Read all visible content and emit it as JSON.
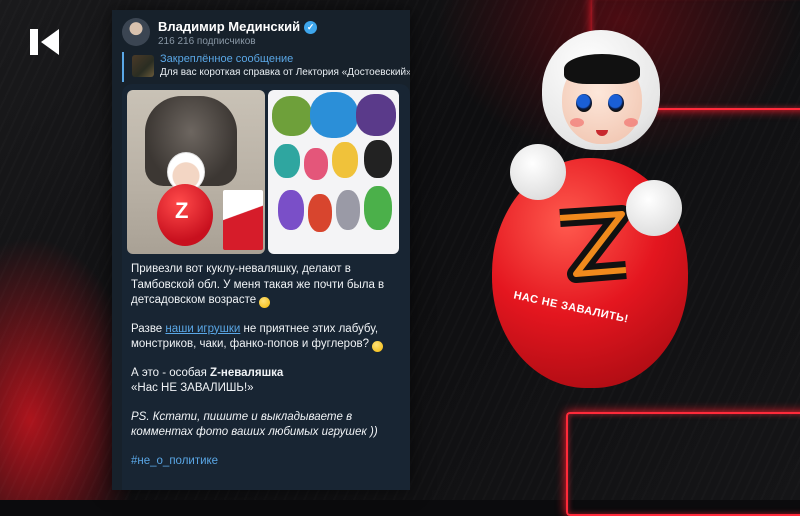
{
  "channel": {
    "name": "Владимир Мединский",
    "subscribers": "216 216 подписчиков"
  },
  "pinned": {
    "title": "Закреплённое сообщение",
    "text": "Для вас короткая справка от Лектория «Достоевский»"
  },
  "post": {
    "paragraph1": "Привезли вот куклу-неваляшку, делают в Тамбовской обл. У меня такая же почти была в детсадовском возрасте",
    "paragraph2_before": "Разве ",
    "paragraph2_link": "наши игрушки",
    "paragraph2_after": " не приятнее этих лабубу, монстриков, чаки, фанко-попов и фуглеров?",
    "paragraph3_before": "А это - особая ",
    "paragraph3_bold": "Z-неваляшка",
    "paragraph3_quote": "«Нас НЕ ЗАВАЛИШЬ!»",
    "paragraph4": "PS. Кстати, пишите и выкладываете в комментах фото ваших любимых игрушек ))",
    "hashtag": "#не_о_политике"
  },
  "doll": {
    "slogan": "НАС НЕ ЗАВАЛИТЬ!"
  },
  "colors": {
    "accent_red": "#ff2a3a",
    "telegram_bg": "#17212b",
    "telegram_link": "#5aa7e6"
  }
}
